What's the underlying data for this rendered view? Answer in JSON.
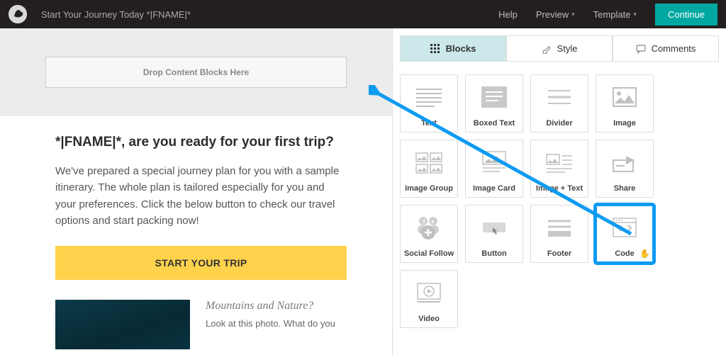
{
  "header": {
    "title": "Start Your Journey Today *|FNAME|*",
    "help": "Help",
    "preview": "Preview",
    "template": "Template",
    "continue": "Continue"
  },
  "canvas": {
    "dropzone": "Drop Content Blocks Here",
    "heading": "*|FNAME|*, are you ready for your first trip?",
    "body": "We've prepared a special journey plan for you with a sample itinerary. The whole plan is tailored especially for you and your preferences. Click the below button to check our travel options and start packing now!",
    "cta": "START YOUR TRIP",
    "article": {
      "title": "Mountains and Nature?",
      "excerpt": "Look at this photo. What do you"
    }
  },
  "sidebar": {
    "tabs": {
      "blocks": "Blocks",
      "style": "Style",
      "comments": "Comments"
    },
    "blocks": [
      {
        "label": "Text"
      },
      {
        "label": "Boxed Text"
      },
      {
        "label": "Divider"
      },
      {
        "label": "Image"
      },
      {
        "label": "Image Group"
      },
      {
        "label": "Image Card"
      },
      {
        "label": "Image + Text"
      },
      {
        "label": "Share"
      },
      {
        "label": "Social Follow"
      },
      {
        "label": "Button"
      },
      {
        "label": "Footer"
      },
      {
        "label": "Code"
      },
      {
        "label": "Video"
      }
    ]
  }
}
